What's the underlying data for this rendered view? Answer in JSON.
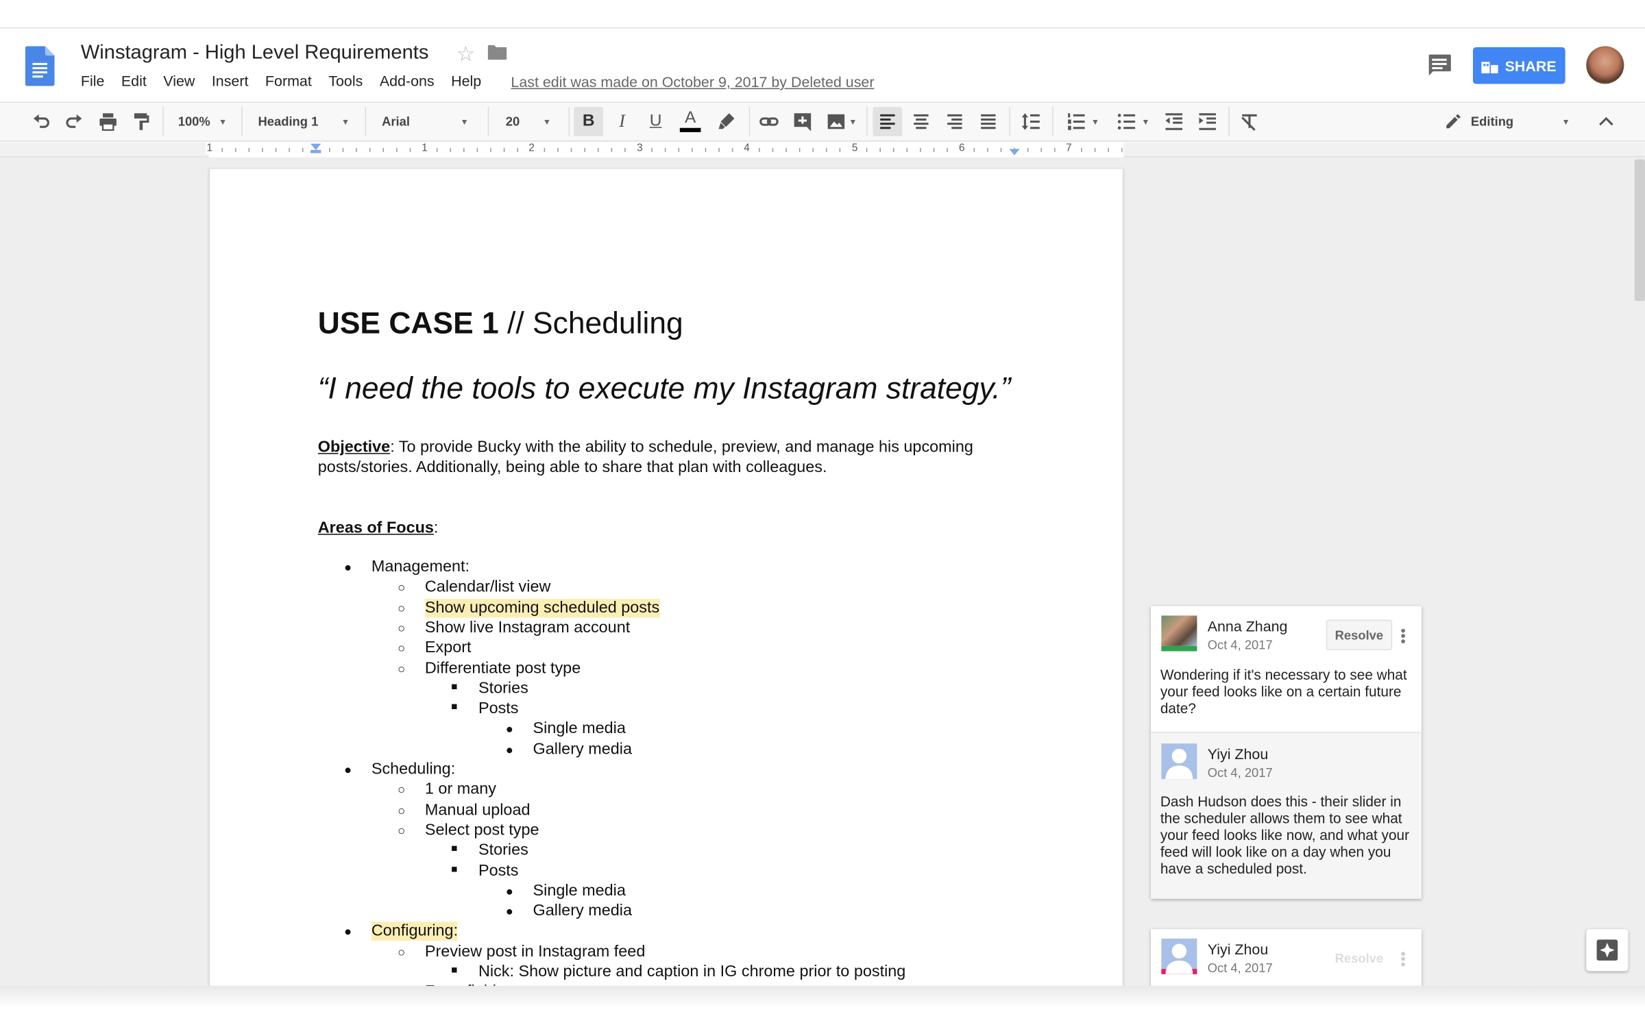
{
  "doc": {
    "title": "Winstagram - High Level Requirements",
    "last_edit": "Last edit was made on October 9, 2017 by Deleted user"
  },
  "menu": [
    "File",
    "Edit",
    "View",
    "Insert",
    "Format",
    "Tools",
    "Add-ons",
    "Help"
  ],
  "share_label": "SHARE",
  "toolbar": {
    "zoom": "100%",
    "style": "Heading 1",
    "font": "Arial",
    "size": "20",
    "mode": "Editing"
  },
  "ruler_labels": [
    "1",
    "1",
    "2",
    "3",
    "4",
    "5",
    "6",
    "7"
  ],
  "content": {
    "heading_bold": "USE CASE 1",
    "heading_rest": " // Scheduling",
    "quote": "“I need the tools to execute my Instagram strategy.”",
    "objective_label": "Objective",
    "objective_text": ": To provide Bucky with the ability to schedule, preview, and manage his upcoming posts/stories. Additionally, being able to share that plan with colleagues.",
    "areas_label": "Areas of Focus",
    "areas_colon": ":",
    "items": [
      {
        "level": 1,
        "text": "Management:",
        "hl": false
      },
      {
        "level": 2,
        "text": "Calendar/list view",
        "hl": false
      },
      {
        "level": 2,
        "text": "Show upcoming scheduled posts",
        "hl": true
      },
      {
        "level": 2,
        "text": "Show live Instagram account",
        "hl": false
      },
      {
        "level": 2,
        "text": "Export",
        "hl": false
      },
      {
        "level": 2,
        "text": "Differentiate post type",
        "hl": false
      },
      {
        "level": 3,
        "text": "Stories",
        "hl": false
      },
      {
        "level": 3,
        "text": "Posts",
        "hl": false
      },
      {
        "level": 4,
        "text": "Single media",
        "hl": false
      },
      {
        "level": 4,
        "text": "Gallery media",
        "hl": false
      },
      {
        "level": 1,
        "text": "Scheduling:",
        "hl": false
      },
      {
        "level": 2,
        "text": "1 or many",
        "hl": false
      },
      {
        "level": 2,
        "text": "Manual upload",
        "hl": false
      },
      {
        "level": 2,
        "text": "Select post type",
        "hl": false
      },
      {
        "level": 3,
        "text": "Stories",
        "hl": false
      },
      {
        "level": 3,
        "text": "Posts",
        "hl": false
      },
      {
        "level": 4,
        "text": "Single media",
        "hl": false
      },
      {
        "level": 4,
        "text": "Gallery media",
        "hl": false
      },
      {
        "level": 1,
        "text": "Configuring:",
        "hl": true
      },
      {
        "level": 2,
        "text": "Preview post in Instagram feed",
        "hl": false
      },
      {
        "level": 3,
        "text": "Nick: Show picture and caption in IG chrome prior to posting",
        "hl": false
      },
      {
        "level": 2,
        "text": "Form fields",
        "hl": false
      }
    ]
  },
  "comments": {
    "thread1": {
      "first": {
        "author": "Anna Zhang",
        "date": "Oct 4, 2017",
        "text": "Wondering if it's necessary to see what your feed looks like on a certain future date?"
      },
      "reply": {
        "author": "Yiyi Zhou",
        "date": "Oct 4, 2017",
        "text": "Dash Hudson does this - their slider in the scheduler allows them to see what your feed looks like now, and what your feed will look like on a day when you have a scheduled post."
      },
      "resolve": "Resolve"
    },
    "thread2": {
      "first": {
        "author": "Yiyi Zhou",
        "date": "Oct 4, 2017"
      },
      "resolve": "Resolve"
    }
  },
  "colors": {
    "accent": "#4285f4",
    "highlight": "#fbeeb5",
    "docs_blue": "#4a86e8"
  }
}
